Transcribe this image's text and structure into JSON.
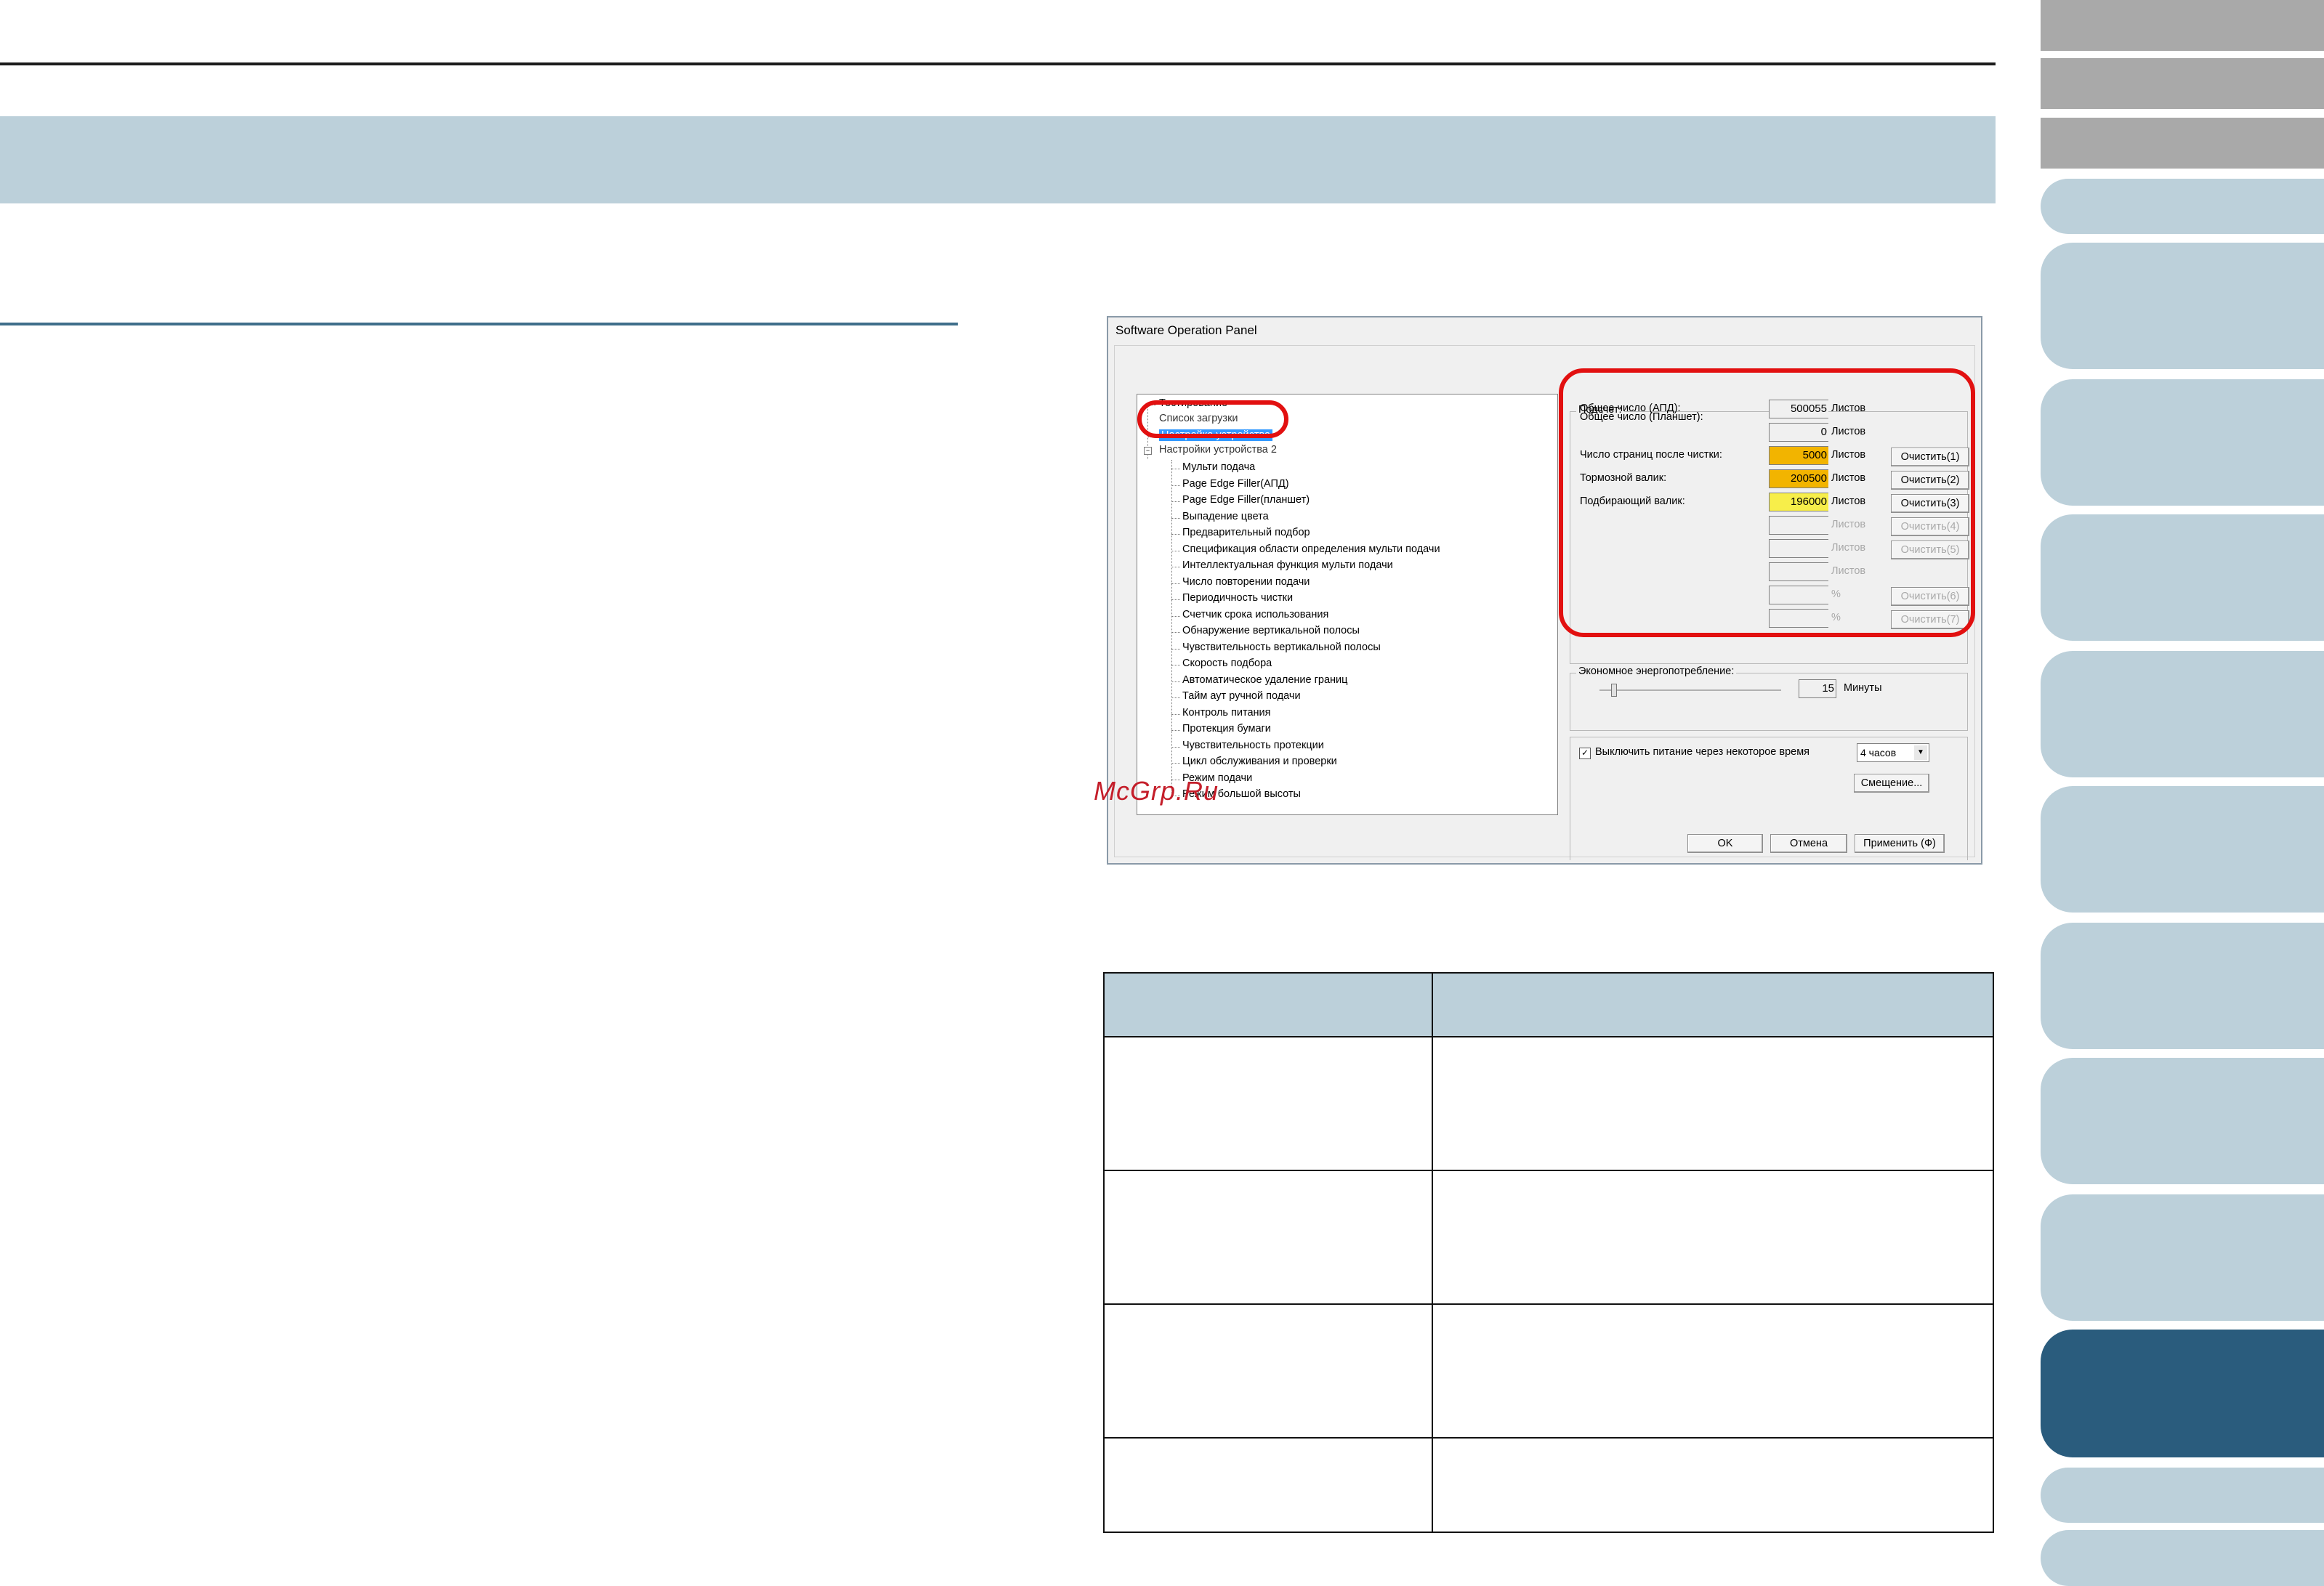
{
  "dialog": {
    "title": "Software Operation Panel",
    "tree": {
      "top_items": [
        "Тестирование",
        "Настройка устройства"
      ],
      "partial_items": [
        "Список загрузки",
        "Настройки устройства 2"
      ],
      "selected": "Настройка устройства",
      "sub_items": [
        "Мульти подача",
        "Page Edge Filler(АПД)",
        "Page Edge Filler(планшет)",
        "Выпадение цвета",
        "Предварительный подбор",
        "Спецификация области определения мульти подачи",
        "Интеллектуальная функция мульти подачи",
        "Число повторении подачи",
        "Периодичность чистки",
        "Счетчик срока использования",
        "Обнаружение вертикальной полосы",
        "Чувствительность вертикальной полосы",
        "Скорость подбора",
        "Автоматическое удаление границ",
        "Тайм аут ручной подачи",
        "Контроль питания",
        "Протекция бумаги",
        "Чувствительность протекции",
        "Цикл обслуживания и проверки",
        "Режим подачи",
        "Режим большой высоты"
      ]
    },
    "counter": {
      "group_label": "Подсчет:",
      "rows": [
        {
          "label": "Общее число (АПД):",
          "value": "500055",
          "unit": "Листов",
          "color": "none"
        },
        {
          "label": "Общее число (Планшет):",
          "value": "0",
          "unit": "Листов",
          "color": "none"
        },
        {
          "label": "Число страниц после чистки:",
          "value": "5000",
          "unit": "Листов",
          "button": "Очистить(1)",
          "color": "#f2b400"
        },
        {
          "label": "Тормозной валик:",
          "value": "200500",
          "unit": "Листов",
          "button": "Очистить(2)",
          "color": "#f2b400"
        },
        {
          "label": "Подбирающий валик:",
          "value": "196000",
          "unit": "Листов",
          "button": "Очистить(3)",
          "color": "#f7ee4a"
        }
      ],
      "disabled_rows": [
        {
          "unit": "Листов",
          "button": "Очистить(4)"
        },
        {
          "unit": "Листов",
          "button": "Очистить(5)"
        },
        {
          "unit": "Листов",
          "button": ""
        },
        {
          "unit": "%",
          "button": "Очистить(6)"
        },
        {
          "unit": "%",
          "button": "Очистить(7)"
        }
      ]
    },
    "power": {
      "group_label": "Экономное энергопотребление:",
      "minutes_value": "15",
      "minutes_unit": "Минуты",
      "auto_off_label": "Выключить питание через некоторое время",
      "auto_off_checked": true,
      "auto_off_select": "4 часов",
      "offset_button": "Смещение..."
    },
    "buttons": {
      "ok": "OK",
      "cancel": "Отмена",
      "apply": "Применить (Ф)"
    }
  },
  "watermark": "McGrp.Ru",
  "colors": {
    "header_band": "#bcd0da",
    "active_tab": "#2a5c7d",
    "highlight": "#e21010"
  }
}
